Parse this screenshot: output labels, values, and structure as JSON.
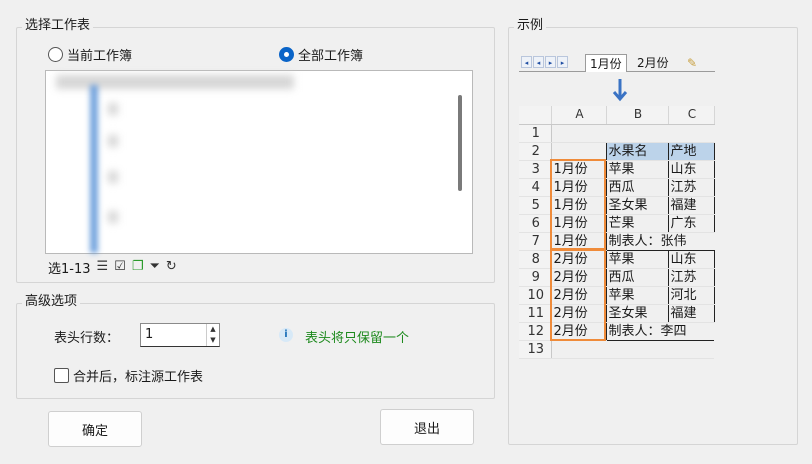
{
  "select_group": {
    "title": "选择工作表",
    "radio_current": "当前工作簿",
    "radio_all": "全部工作簿",
    "selected_radio": "全部工作簿",
    "selection_count": "选1-13"
  },
  "advanced_group": {
    "title": "高级选项",
    "header_rows_label": "表头行数：",
    "header_rows_value": "1",
    "info_text": "表头将只保留一个",
    "mark_source_label": "合并后，标注源工作表",
    "mark_source_checked": false
  },
  "buttons": {
    "ok": "确定",
    "exit": "退出"
  },
  "example": {
    "title": "示例",
    "tabs": [
      "1月份",
      "2月份"
    ],
    "active_tab": "1月份",
    "columns": [
      "A",
      "B",
      "C"
    ],
    "rows": [
      {
        "n": "1",
        "a": "",
        "b": "",
        "c": ""
      },
      {
        "n": "2",
        "a": "",
        "b": "水果名",
        "c": "产地"
      },
      {
        "n": "3",
        "a": "1月份",
        "b": "苹果",
        "c": "山东"
      },
      {
        "n": "4",
        "a": "1月份",
        "b": "西瓜",
        "c": "江苏"
      },
      {
        "n": "5",
        "a": "1月份",
        "b": "圣女果",
        "c": "福建"
      },
      {
        "n": "6",
        "a": "1月份",
        "b": "芒果",
        "c": "广东"
      },
      {
        "n": "7",
        "a": "1月份",
        "b": "制表人：张伟",
        "c": ""
      },
      {
        "n": "8",
        "a": "2月份",
        "b": "苹果",
        "c": "山东"
      },
      {
        "n": "9",
        "a": "2月份",
        "b": "西瓜",
        "c": "江苏"
      },
      {
        "n": "10",
        "a": "2月份",
        "b": "苹果",
        "c": "河北"
      },
      {
        "n": "11",
        "a": "2月份",
        "b": "圣女果",
        "c": "福建"
      },
      {
        "n": "12",
        "a": "2月份",
        "b": "制表人：李四",
        "c": ""
      },
      {
        "n": "13",
        "a": "",
        "b": "",
        "c": ""
      }
    ]
  },
  "colors": {
    "accent": "#0a64c8",
    "info_green": "#1e8a1e",
    "highlight_orange": "#ef8b3a",
    "arrow_blue": "#3a73c4"
  }
}
